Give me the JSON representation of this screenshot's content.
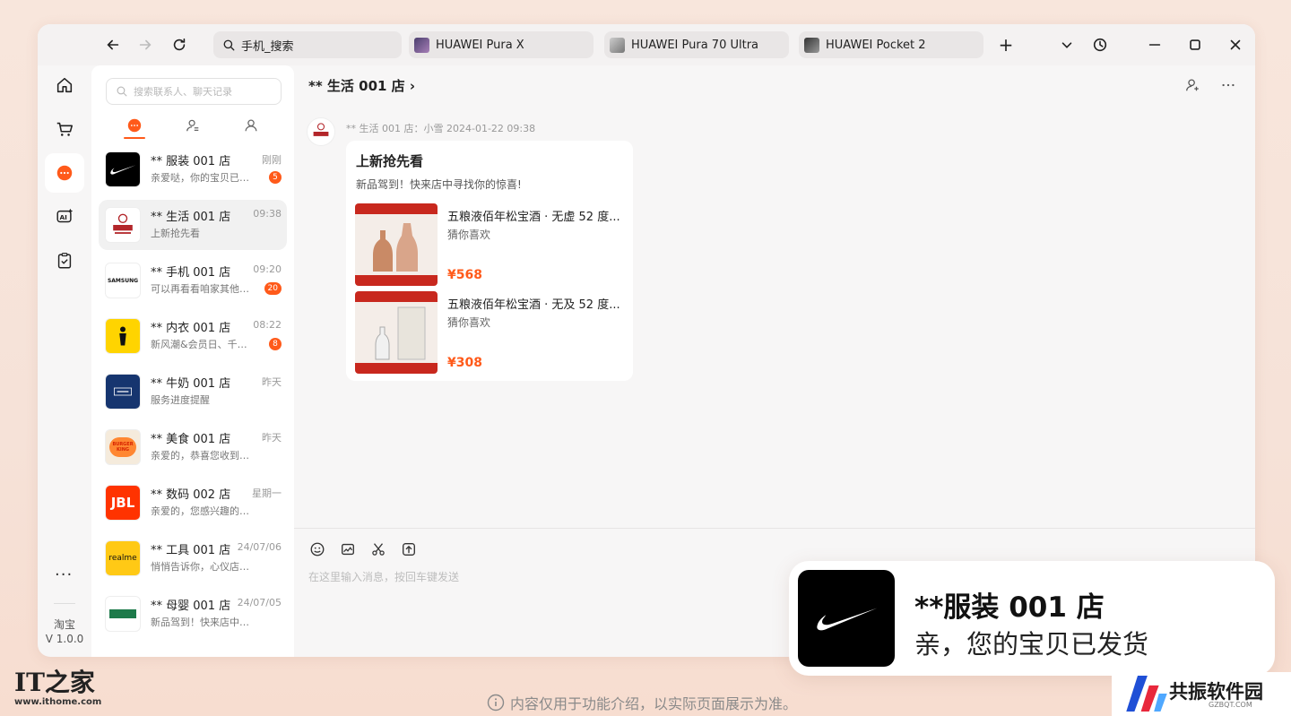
{
  "titlebar": {
    "address": "手机_搜索",
    "tabs": [
      {
        "label": "HUAWEI Pura X"
      },
      {
        "label": "HUAWEI Pura 70 Ultra"
      },
      {
        "label": "HUAWEI Pocket 2"
      }
    ],
    "new_tab": "+"
  },
  "rail": {
    "more": "···",
    "app_name": "淘宝",
    "app_version": "V 1.0.0"
  },
  "conversations": {
    "search_placeholder": "搜索联系人、聊天记录",
    "items": [
      {
        "name": "** 服装 001 店",
        "message": "亲爱哒，你的宝贝已发货",
        "time": "刚刚",
        "badge": "5"
      },
      {
        "name": "** 生活 001 店",
        "message": "上新抢先看",
        "time": "09:38",
        "badge": ""
      },
      {
        "name": "** 手机 001 店",
        "message": "可以再看看咱家其他宝贝",
        "time": "09:20",
        "badge": "20"
      },
      {
        "name": "** 内衣 001 店",
        "message": "新风潮&会员日、千万好礼",
        "time": "08:22",
        "badge": "8"
      },
      {
        "name": "** 牛奶 001 店",
        "message": "服务进度提醒",
        "time": "昨天",
        "badge": ""
      },
      {
        "name": "** 美食 001 店",
        "message": "亲爱的，恭喜您收到我店优惠",
        "time": "昨天",
        "badge": ""
      },
      {
        "name": "** 数码 002 店",
        "message": "亲爱的，您感兴趣的宝贝降价",
        "time": "星期一",
        "badge": ""
      },
      {
        "name": "** 工具 001 店",
        "message": "悄悄告诉你，心仪店铺上新啦",
        "time": "24/07/06",
        "badge": ""
      },
      {
        "name": "** 母婴 001 店",
        "message": "新品驾到！快来店中寻找你的惊喜",
        "time": "24/07/05",
        "badge": ""
      }
    ],
    "avatar_labels": {
      "samsung": "SAMSUNG",
      "jbl": "JBL",
      "realme": "realme",
      "bk": "BURGER KING"
    }
  },
  "chat": {
    "title": "** 生活 001 店 ›",
    "message_meta": "** 生活 001 店：小雪   2024-01-22 09:38",
    "card": {
      "title": "上新抢先看",
      "subtitle": "新品驾到！快来店中寻找你的惊喜!",
      "products": [
        {
          "name": "五粮液佰年松宝酒 · 无虚 52 度...",
          "tag": "猜你喜欢",
          "price": "¥568"
        },
        {
          "name": "五粮液佰年松宝酒 · 无及 52 度...",
          "tag": "猜你喜欢",
          "price": "¥308"
        }
      ]
    },
    "input_placeholder": "在这里输入消息，按回车键发送"
  },
  "toast": {
    "title": "**服装 001 店",
    "body": "亲，您的宝贝已发货"
  },
  "footer": {
    "disclaimer": "内容仅用于功能介绍，以实际页面展示为准。",
    "ithome_mark": "IT之家",
    "ithome_url": "www.ithome.com",
    "gz_name": "共振软件园",
    "gz_sub": "GZBQT.COM"
  },
  "colors": {
    "accent": "#ff5a1a",
    "background": "#f8e6dc"
  }
}
